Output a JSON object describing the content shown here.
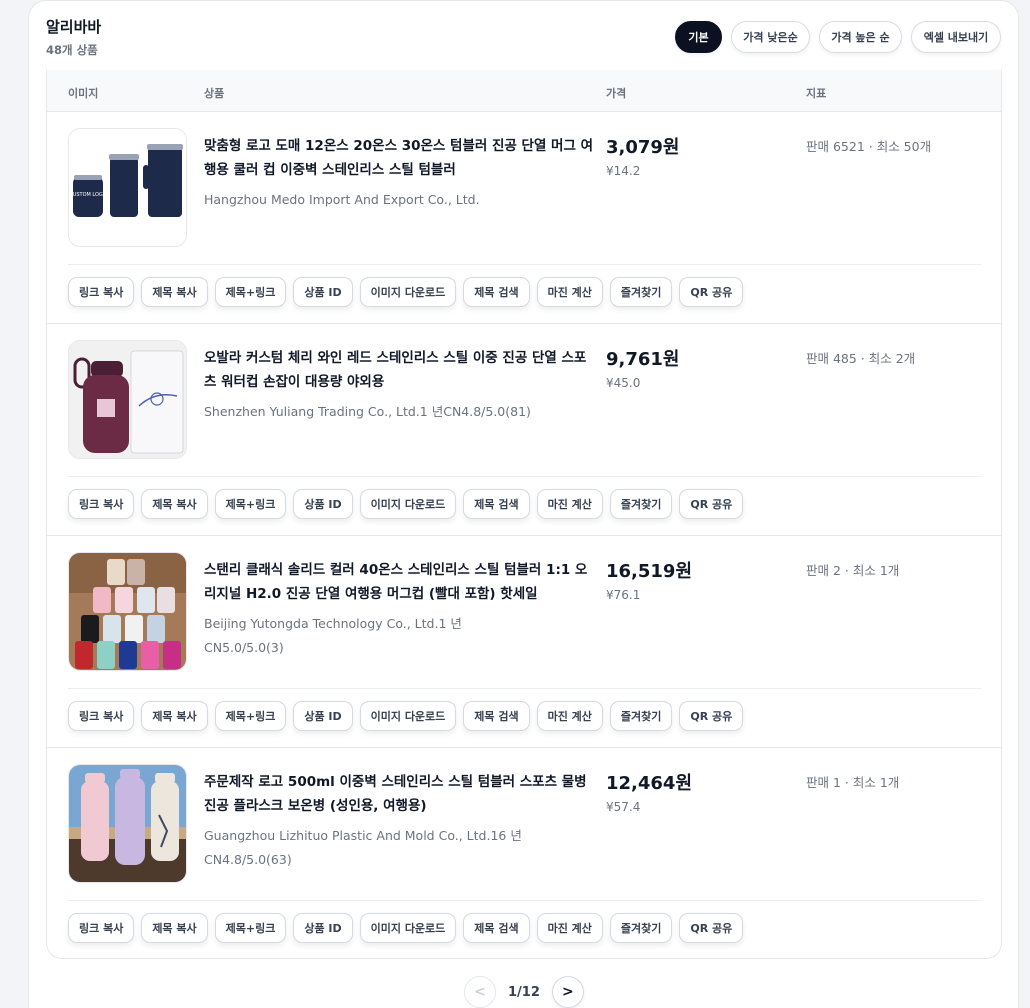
{
  "header": {
    "title": "알리바바",
    "count": "48개 상품"
  },
  "toolbar": {
    "default": "기본",
    "price_low": "가격 낮은순",
    "price_high": "가격 높은 순",
    "export": "엑셀 내보내기"
  },
  "columns": {
    "image": "이미지",
    "product": "상품",
    "price": "가격",
    "metric": "지표"
  },
  "actions": [
    "링크 복사",
    "제목 복사",
    "제목+링크",
    "상품 ID",
    "이미지 다운로드",
    "제목 검색",
    "마진 계산",
    "즐겨찾기",
    "QR 공유"
  ],
  "products": [
    {
      "title": "맞춤형 로고 도매 12온스 20온스 30온스 텀블러 진공 단열 머그 여행용 쿨러 컵 이중벽 스테인리스 스틸 텀블러",
      "supplier": "Hangzhou Medo Import And Export Co., Ltd.",
      "price": "3,079원",
      "yuan": "¥14.2",
      "metric": "판매 6521 · 최소 50개",
      "image_label": "CUSTOM LOGO"
    },
    {
      "title": "오발라 커스텀 체리 와인 레드 스테인리스 스틸 이중 진공 단열 스포츠 워터컵 손잡이 대용량 야외용",
      "supplier": "Shenzhen Yuliang Trading Co., Ltd.1 년CN4.8/5.0(81)",
      "price": "9,761원",
      "yuan": "¥45.0",
      "metric": "판매 485 · 최소 2개"
    },
    {
      "title": "스탠리 클래식 솔리드 컬러 40온스 스테인리스 스틸 텀블러 1:1 오리지널 H2.0 진공 단열 여행용 머그컵 (빨대 포함) 핫세일",
      "supplier": "Beijing Yutongda Technology Co., Ltd.1 년CN5.0/5.0(3)",
      "price": "16,519원",
      "yuan": "¥76.1",
      "metric": "판매 2 · 최소 1개"
    },
    {
      "title": "주문제작 로고 500ml 이중벽 스테인리스 스틸 텀블러 스포츠 물병 진공 플라스크 보온병 (성인용, 여행용)",
      "supplier": "Guangzhou Lizhituo Plastic And Mold Co., Ltd.16 년 CN4.8/5.0(63)",
      "price": "12,464원",
      "yuan": "¥57.4",
      "metric": "판매 1 · 최소 1개"
    }
  ],
  "pagination": {
    "prev": "<",
    "info": "1/12",
    "next": ">"
  }
}
